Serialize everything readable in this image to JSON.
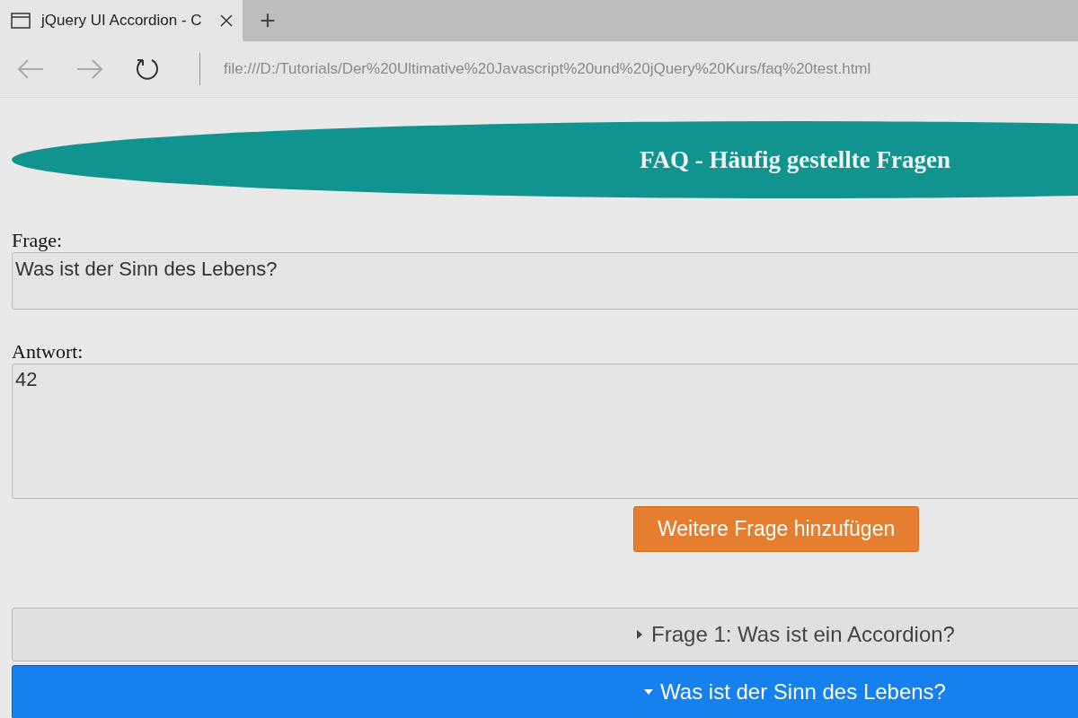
{
  "browser": {
    "tabs": [
      {
        "title": "jQuery UI Accordion - C",
        "selected": true
      }
    ],
    "new_tab": "+",
    "address": "file:///D:/Tutorials/Der%20Ultimative%20Javascript%20und%20jQuery%20Kurs/faq%20test.html"
  },
  "heading": "FAQ - Häufig gestellte Fragen",
  "question_field": {
    "label": "Frage:",
    "value": "Was ist der Sinn des Lebens?"
  },
  "answer_field": {
    "label": "Antwort:",
    "value": "42"
  },
  "add_button": "Weitere Frage hinzufügen",
  "accordion": [
    {
      "title": "Frage 1: Was ist ein Accordion?",
      "expanded": false
    },
    {
      "title": "Was ist der Sinn des Lebens?",
      "expanded": true
    }
  ]
}
